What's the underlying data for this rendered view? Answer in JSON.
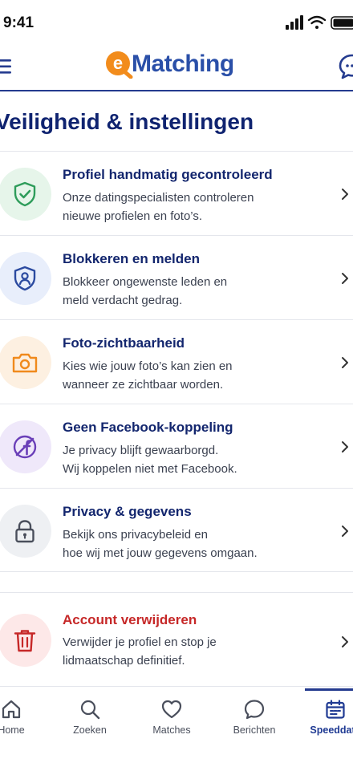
{
  "status_bar": {
    "time": "9:41"
  },
  "header": {
    "logo_text": "Matching",
    "logo_letter": "e",
    "brand_color": "#2a4fa8",
    "accent_color": "#f28c1c"
  },
  "page": {
    "title": "Veiligheid & instellingen"
  },
  "items": [
    {
      "title": "Profiel handmatig gecontroleerd",
      "desc_line1": "Onze datingspecialisten controleren",
      "desc_line2": "nieuwe profielen en foto’s.",
      "icon": "shield-check-icon",
      "color": "#2e9c5a"
    },
    {
      "title": "Blokkeren en melden",
      "desc_line1": "Blokkeer ongewenste leden en",
      "desc_line2": "meld verdacht gedrag.",
      "icon": "shield-user-icon",
      "color": "#2b4aa0"
    },
    {
      "title": "Foto-zichtbaarheid",
      "desc_line1": "Kies wie jouw foto’s kan zien en",
      "desc_line2": "wanneer ze zichtbaar worden.",
      "icon": "camera-icon",
      "color": "#f08a1c"
    },
    {
      "title": "Geen Facebook-koppeling",
      "desc_line1": "Je privacy blijft gewaarborgd.",
      "desc_line2": "Wij koppelen niet met Facebook.",
      "icon": "no-facebook-icon",
      "color": "#6a3fb8"
    },
    {
      "title": "Privacy & gegevens",
      "desc_line1": "Bekijk ons privacybeleid en",
      "desc_line2": "hoe wij met jouw gegevens omgaan.",
      "icon": "lock-icon",
      "color": "#4a4f5c"
    }
  ],
  "delete": {
    "title": "Account verwijderen",
    "desc_line1": "Verwijder je profiel en stop je",
    "desc_line2": "lidmaatschap definitief.",
    "icon": "trash-icon",
    "color": "#c62828"
  },
  "tabs": [
    {
      "label": "Home",
      "icon": "home-icon"
    },
    {
      "label": "Zoeken",
      "icon": "search-icon"
    },
    {
      "label": "Matches",
      "icon": "heart-icon"
    },
    {
      "label": "Berichten",
      "icon": "chat-bubble-icon"
    },
    {
      "label": "Speeddate",
      "icon": "calendar-icon",
      "active": true
    }
  ]
}
